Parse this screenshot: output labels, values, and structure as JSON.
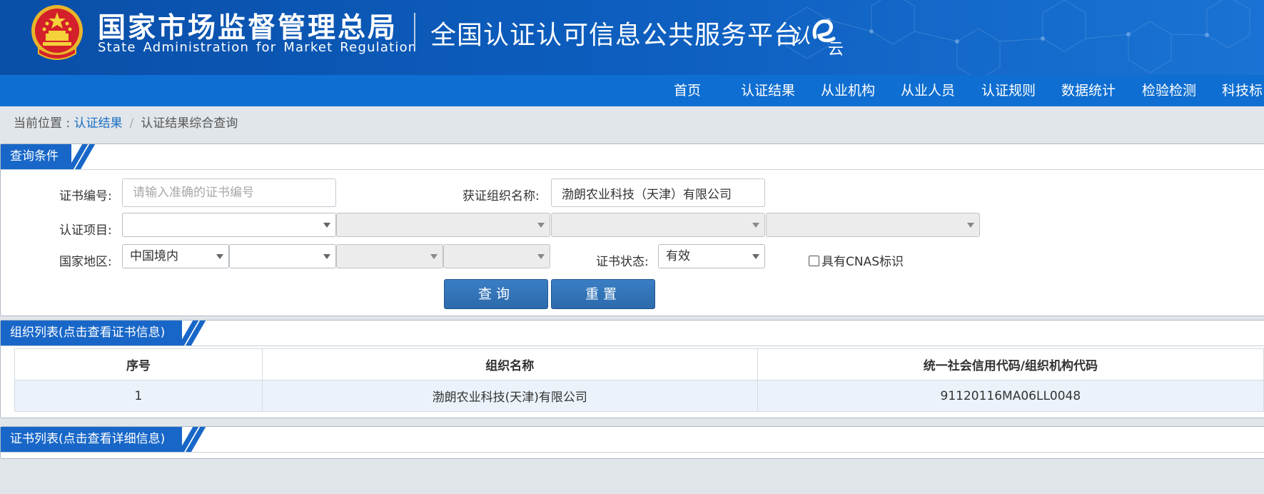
{
  "header": {
    "org_name_cn": "国家市场监督管理总局",
    "org_name_en": "State Administration  for  Market Regulation",
    "platform_title": "全国认证认可信息公共服务平台",
    "logo_text": "认e云",
    "brand_color": "#0c5cbc"
  },
  "nav": {
    "items": [
      {
        "label": "首页"
      },
      {
        "label": "认证结果"
      },
      {
        "label": "从业机构"
      },
      {
        "label": "从业人员"
      },
      {
        "label": "认证规则"
      },
      {
        "label": "数据统计"
      },
      {
        "label": "检验检测"
      },
      {
        "label": "科技标"
      }
    ]
  },
  "breadcrumb": {
    "prefix": "当前位置 : ",
    "link": "认证结果",
    "separator": "/",
    "current": "认证结果综合查询"
  },
  "query_panel": {
    "title": "查询条件",
    "cert_no_label": "证书编号:",
    "cert_no_placeholder": "请输入准确的证书编号",
    "cert_no_value": "",
    "org_name_label": "获证组织名称:",
    "org_name_value": "渤朗农业科技（天津）有限公司",
    "project_label": "认证项目:",
    "project_selects": [
      "",
      "",
      "",
      ""
    ],
    "region_label": "国家地区:",
    "region_selects": [
      "中国境内",
      "",
      "",
      ""
    ],
    "status_label": "证书状态:",
    "status_value": "有效",
    "cnas_label": "具有CNAS标识",
    "search_button": "查询",
    "reset_button": "重置"
  },
  "org_panel": {
    "title": "组织列表(点击查看证书信息)",
    "columns": [
      "序号",
      "组织名称",
      "统一社会信用代码/组织机构代码"
    ],
    "rows": [
      [
        "1",
        "渤朗农业科技(天津)有限公司",
        "91120116MA06LL0048"
      ]
    ]
  },
  "cert_panel": {
    "title": "证书列表(点击查看详细信息)"
  }
}
